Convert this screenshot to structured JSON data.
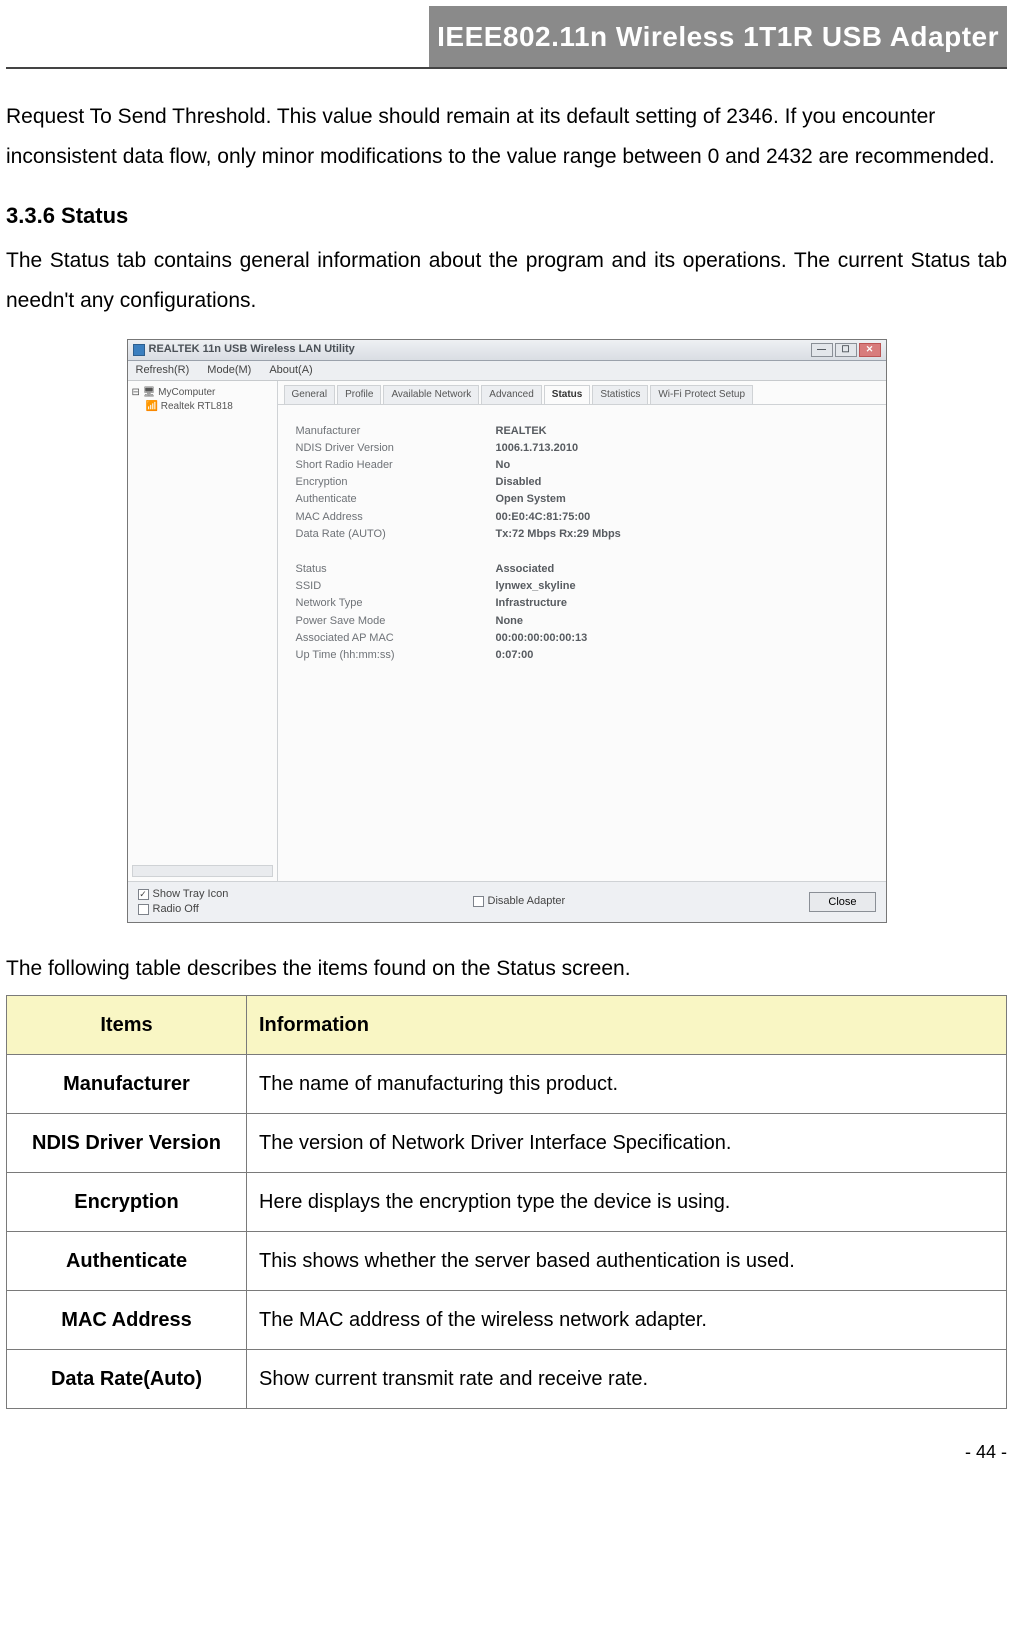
{
  "header": {
    "title": "IEEE802.11n Wireless 1T1R USB Adapter"
  },
  "intro_paragraph": "Request To Send Threshold. This value should remain at its default setting of 2346. If you encounter inconsistent data flow, only minor modifications to the value range between 0 and 2432 are recommended.",
  "section": {
    "number_title": "3.3.6   Status",
    "body": "The Status tab contains general information about the program and its operations. The current Status tab needn't any configurations."
  },
  "screenshot": {
    "window_title": "REALTEK 11n USB Wireless LAN Utility",
    "menus": [
      "Refresh(R)",
      "Mode(M)",
      "About(A)"
    ],
    "tree": [
      "MyComputer",
      "Realtek RTL818"
    ],
    "tabs": [
      "General",
      "Profile",
      "Available Network",
      "Advanced",
      "Status",
      "Statistics",
      "Wi-Fi Protect Setup"
    ],
    "active_tab": "Status",
    "rows1": [
      {
        "k": "Manufacturer",
        "v": "REALTEK"
      },
      {
        "k": "NDIS Driver Version",
        "v": "1006.1.713.2010"
      },
      {
        "k": "Short Radio Header",
        "v": "No"
      },
      {
        "k": "Encryption",
        "v": "Disabled"
      },
      {
        "k": "Authenticate",
        "v": "Open System"
      },
      {
        "k": "MAC Address",
        "v": "00:E0:4C:81:75:00"
      },
      {
        "k": "Data Rate (AUTO)",
        "v": "Tx:72 Mbps Rx:29 Mbps"
      }
    ],
    "rows2": [
      {
        "k": "Status",
        "v": "Associated"
      },
      {
        "k": "SSID",
        "v": "lynwex_skyline"
      },
      {
        "k": "Network Type",
        "v": "Infrastructure"
      },
      {
        "k": "Power Save Mode",
        "v": "None"
      },
      {
        "k": "Associated AP MAC",
        "v": "00:00:00:00:00:13"
      },
      {
        "k": "Up Time (hh:mm:ss)",
        "v": "0:07:00"
      }
    ],
    "checks": {
      "show_tray": {
        "label": "Show Tray Icon",
        "checked": true
      },
      "radio_off": {
        "label": "Radio Off",
        "checked": false
      },
      "disable_adapter": {
        "label": "Disable Adapter",
        "checked": false
      }
    },
    "close_btn": "Close"
  },
  "table_caption": "The following table describes the items found on the Status screen.",
  "table": {
    "head_items": "Items",
    "head_info": "Information",
    "rows": [
      {
        "item": "Manufacturer",
        "info": "The name of manufacturing this product."
      },
      {
        "item": "NDIS Driver Version",
        "info": "The version of Network Driver Interface Specification."
      },
      {
        "item": "Encryption",
        "info": "Here displays the encryption type the device is using."
      },
      {
        "item": "Authenticate",
        "info": "This shows whether the server based authentication is used."
      },
      {
        "item": "MAC Address",
        "info": "The MAC address of the wireless network adapter."
      },
      {
        "item": "Data Rate(Auto)",
        "info": "Show current transmit rate and receive rate."
      }
    ]
  },
  "page_number": "- 44 -"
}
